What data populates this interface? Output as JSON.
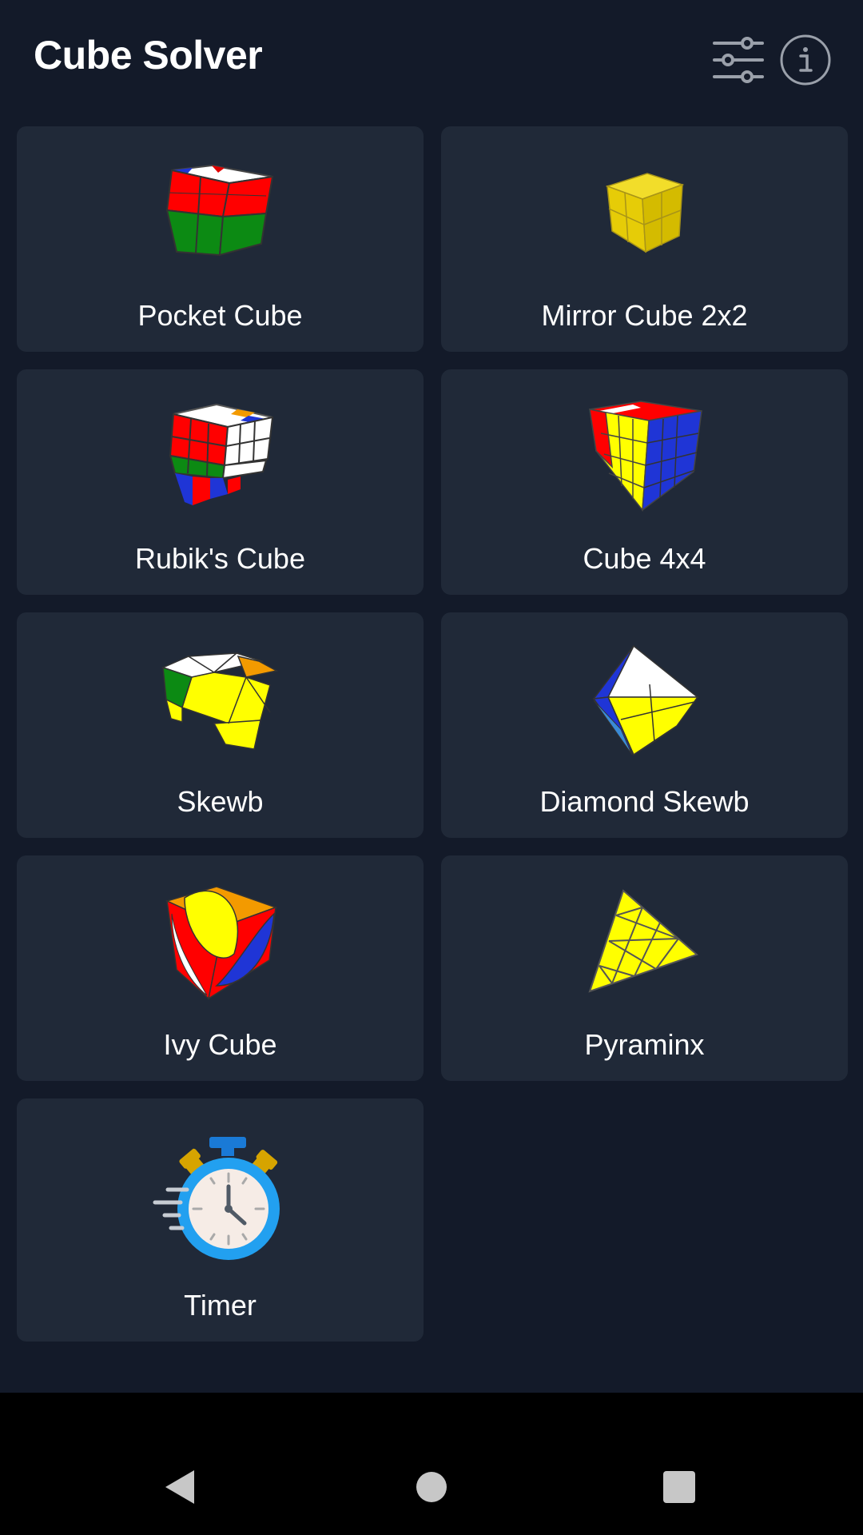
{
  "app": {
    "title": "Cube Solver"
  },
  "header": {
    "settings_icon": "sliders-icon",
    "info_icon": "info-icon"
  },
  "puzzles": [
    {
      "label": "Pocket Cube",
      "icon": "pocket-cube-icon"
    },
    {
      "label": "Mirror Cube 2x2",
      "icon": "mirror-cube-icon"
    },
    {
      "label": "Rubik's Cube",
      "icon": "rubiks-cube-icon"
    },
    {
      "label": "Cube 4x4",
      "icon": "cube-4x4-icon"
    },
    {
      "label": "Skewb",
      "icon": "skewb-icon"
    },
    {
      "label": "Diamond Skewb",
      "icon": "diamond-skewb-icon"
    },
    {
      "label": "Ivy Cube",
      "icon": "ivy-cube-icon"
    },
    {
      "label": "Pyraminx",
      "icon": "pyraminx-icon"
    },
    {
      "label": "Timer",
      "icon": "stopwatch-icon"
    }
  ],
  "colors": {
    "background": "#131a29",
    "card": "#202938",
    "text": "#ffffff",
    "icon_gray": "#9aa0aa"
  },
  "navigation": {
    "back_icon": "back-triangle-icon",
    "home_icon": "home-circle-icon",
    "recents_icon": "recents-square-icon"
  }
}
